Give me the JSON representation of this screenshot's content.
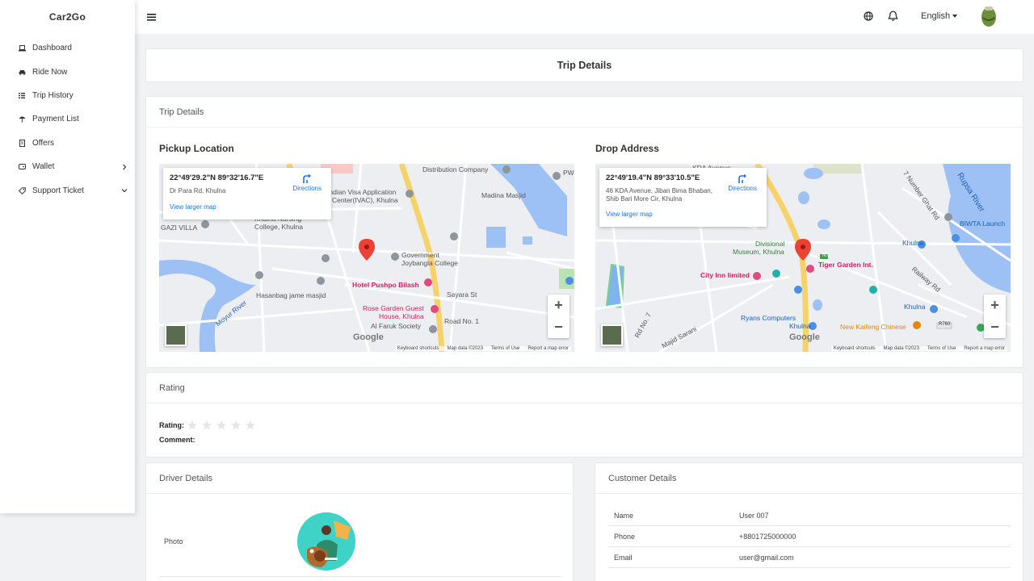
{
  "app": {
    "brand": "Car2Go"
  },
  "sidebar": {
    "items": [
      {
        "label": "Dashboard",
        "icon": "laptop-icon"
      },
      {
        "label": "Ride Now",
        "icon": "car-icon"
      },
      {
        "label": "Trip History",
        "icon": "list-icon"
      },
      {
        "label": "Payment List",
        "icon": "umbrella-icon"
      },
      {
        "label": "Offers",
        "icon": "file-icon"
      },
      {
        "label": "Wallet",
        "icon": "wallet-icon",
        "chevron": "right"
      },
      {
        "label": "Support Ticket",
        "icon": "tag-icon",
        "chevron": "down"
      }
    ]
  },
  "topbar": {
    "language": "English"
  },
  "page": {
    "title": "Trip Details"
  },
  "trip": {
    "header": "Trip Details",
    "pickup": {
      "label": "Pickup Location",
      "coords": "22°49'29.2\"N 89°32'16.7\"E",
      "address": "Dr Para Rd, Khulna",
      "directions": "Directions",
      "larger_map": "View larger map"
    },
    "drop": {
      "label": "Drop Address",
      "coords": "22°49'19.4\"N 89°33'10.5\"E",
      "address_line1": "46 KDA Avenue, Jiban Bima Bhaban,",
      "address_line2": "Shib Bari More Cir, Khulna",
      "directions": "Directions",
      "larger_map": "View larger map"
    },
    "map_footer": {
      "shortcuts": "Keyboard shortcuts",
      "mapdata": "Map data ©2023",
      "terms": "Terms of Use",
      "report": "Report a map error",
      "google": "Google"
    },
    "map1_labels": {
      "distribution": "Distribution Company",
      "visa1": "Indian Visa Application",
      "visa2": "Center(IVAC), Khulna",
      "madina": "Madina Masjid",
      "nursing1": "Khulna Nursing",
      "nursing2": "College, Khulna",
      "gazi": "GAZI VILLA",
      "govt1": "Government",
      "govt2": "Joybangla College",
      "hasanbag": "Hasanbag jame masjid",
      "pushpo": "Hotel Pushpo Bilash",
      "sayara": "Sayara St",
      "rosegarden1": "Rose Garden Guest",
      "rosegarden2": "House, Khulna",
      "road": "Road No. 1",
      "alfaruk": "Al Faruk Society",
      "river": "Moyur River",
      "pw": "PW"
    },
    "map2_labels": {
      "river": "Rupsa River",
      "nghat": "7 Number Ghat Rd",
      "biwta": "BIWTA Launch",
      "khulna1": "Khulna",
      "divisional1": "Divisional",
      "divisional2": "Museum, Khulna",
      "tiger": "Tiger Garden Int.",
      "cityinn": "City Inn limited",
      "railway": "Railway Rd",
      "khulna2": "Khulna",
      "ryans": "Ryans Computers",
      "ryans2": "Khulna",
      "kaifeng": "New Kaifeng Chinese",
      "rdno7": "Rd No. 7",
      "majid": "Majid Sarani",
      "n7": "N7",
      "r760": "R760",
      "kda": "KDA Avenue"
    }
  },
  "rating": {
    "header": "Rating",
    "rating_label": "Rating:",
    "stars_total": 5,
    "stars_filled": 0,
    "comment_label": "Comment:"
  },
  "driver": {
    "header": "Driver Details",
    "photo_label": "Photo"
  },
  "customer": {
    "header": "Customer Details",
    "rows": [
      {
        "key": "Name",
        "value": "User 007"
      },
      {
        "key": "Phone",
        "value": "+8801725000000"
      },
      {
        "key": "Email",
        "value": "user@gmail.com"
      }
    ]
  },
  "colors": {
    "accent": "#1a73e8",
    "pin": "#ea4335",
    "road": "#f6d36a",
    "water": "#9ec1f5",
    "star_empty": "#e6e6e6"
  }
}
